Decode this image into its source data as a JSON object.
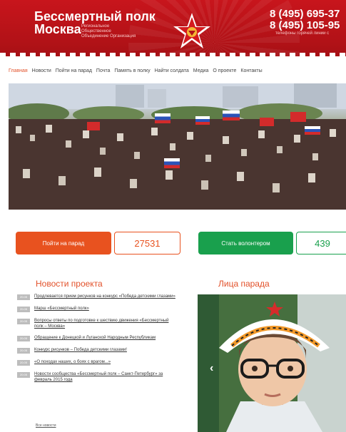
{
  "header": {
    "title_line1": "Бессмертный полк",
    "title_line2": "Москва",
    "subtitle": "Региональное Общественное Объединение Организация",
    "phone1": "8 (495) 695-37",
    "phone2": "8 (495) 105-95",
    "phones_note": "телефоны горячей линии с",
    "logo_icon": "star-emblem-icon"
  },
  "nav": {
    "items": [
      {
        "label": "Главная",
        "active": true
      },
      {
        "label": "Новости"
      },
      {
        "label": "Пойти на парад"
      },
      {
        "label": "Почта"
      },
      {
        "label": "Память в полку"
      },
      {
        "label": "Найти солдата"
      },
      {
        "label": "Медиа"
      },
      {
        "label": "О проекте"
      },
      {
        "label": "Контакты"
      }
    ]
  },
  "actions": {
    "parade_label": "Пойти на парад",
    "parade_count": "27531",
    "volunteer_label": "Стать волонтером",
    "volunteer_count": "439"
  },
  "news": {
    "title": "Новости проекта",
    "items": [
      {
        "date": "20.05",
        "text": "Продлевается прием рисунков на конкурс «Победа детскими глазами»"
      },
      {
        "date": "20.05",
        "text": "Марш «Бессмертный полк»"
      },
      {
        "date": "20.05",
        "text": "Вопросы ответы по подготовке к шествию движения «Бессмертный полк – Москва»"
      },
      {
        "date": "20.05",
        "text": "Обращение к Донецкой и Луганской Народным Республикам"
      },
      {
        "date": "20.05",
        "text": "Конкурс рисунков – Победа детскими глазами!"
      },
      {
        "date": "20.05",
        "text": "«О походах наших, о боях с врагом...»"
      },
      {
        "date": "20.05",
        "text": "Новости сообщества «Бессмертный полк – Санкт-Петербург» за февраль 2015 года"
      }
    ],
    "all_link": "Все новости"
  },
  "faces": {
    "title": "Лица парада",
    "prev_icon": "chevron-left-icon"
  },
  "colors": {
    "brand_red": "#c8151c",
    "accent_orange": "#e8521f",
    "accent_green": "#19a04d"
  }
}
